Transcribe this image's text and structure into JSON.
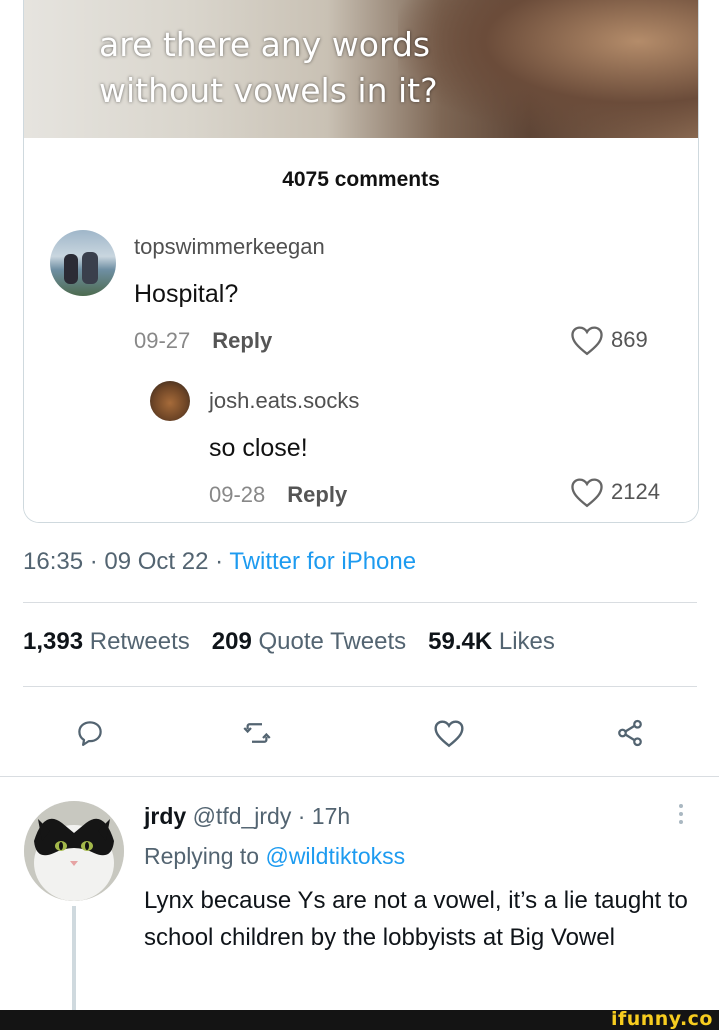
{
  "embed": {
    "video_caption": "are there any words without vowels in it?",
    "comment_count": "4075 comments",
    "comments": [
      {
        "user": "topswimmerkeegan",
        "text": "Hospital?",
        "date": "09-27",
        "reply_label": "Reply",
        "likes": "869"
      },
      {
        "user": "josh.eats.socks",
        "text": "so close!",
        "date": "09-28",
        "reply_label": "Reply",
        "likes": "2124"
      }
    ]
  },
  "tweet": {
    "timestamp": "16:35 · 09 Oct 22 · ",
    "source": "Twitter for iPhone",
    "stats": {
      "retweets_count": "1,393",
      "retweets_label": "Retweets",
      "quotes_count": "209",
      "quotes_label": "Quote Tweets",
      "likes_count": "59.4K",
      "likes_label": "Likes"
    },
    "actions": [
      "reply-icon",
      "retweet-icon",
      "like-icon",
      "share-icon"
    ]
  },
  "reply": {
    "display_name": "jrdy",
    "handle_time": " @tfd_jrdy · 17h",
    "replying_prefix": "Replying to ",
    "replying_to": "@wildtiktokss",
    "body": "Lynx because Ys are not a vowel, it’s a lie taught to school children by the lobbyists at Big Vowel"
  },
  "watermark": "ifunny.co",
  "colors": {
    "link": "#1d9bf0",
    "secondary_text": "#536471",
    "watermark": "#f7cd1f"
  }
}
